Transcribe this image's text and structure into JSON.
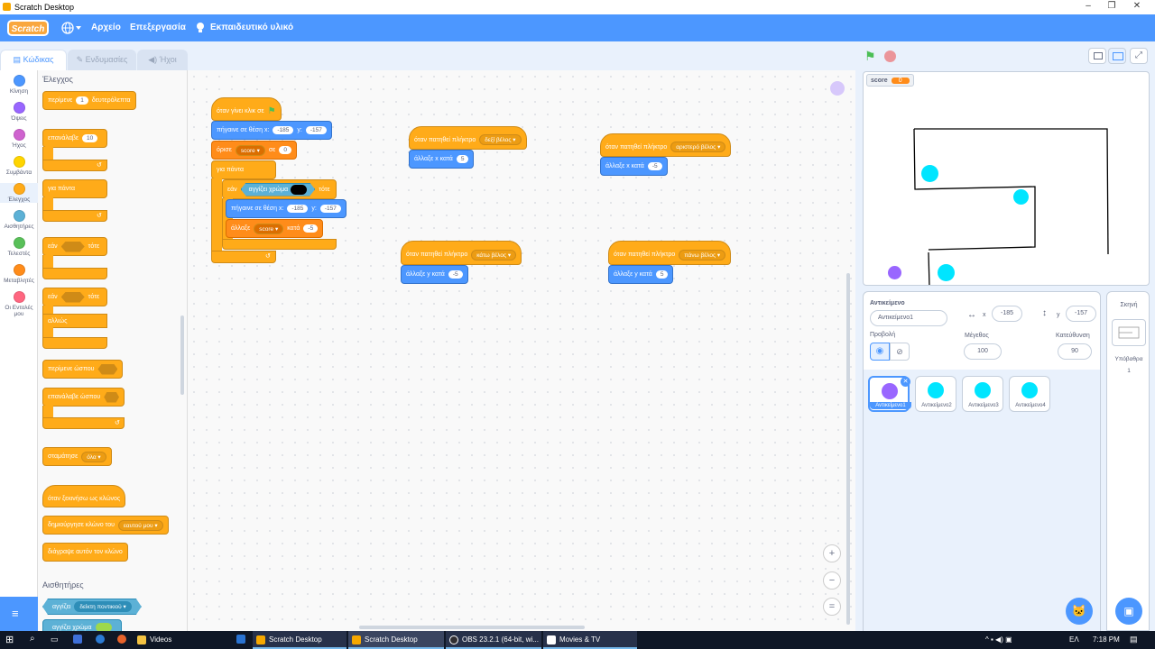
{
  "window": {
    "title": "Scratch Desktop",
    "minimize": "–",
    "restore": "❐",
    "close": "✕"
  },
  "menubar": {
    "logo": "Scratch",
    "file": "Αρχείο",
    "edit": "Επεξεργασία",
    "tutorials": "Εκπαιδευτικό υλικό"
  },
  "tabs": {
    "code": "Κώδικας",
    "costumes": "Ενδυμασίες",
    "sounds": "Ήχοι"
  },
  "categories": [
    {
      "label": "Κίνηση",
      "color": "#4c97ff"
    },
    {
      "label": "Όψεις",
      "color": "#9966ff"
    },
    {
      "label": "Ήχος",
      "color": "#cf63cf"
    },
    {
      "label": "Συμβάντα",
      "color": "#ffd500"
    },
    {
      "label": "Έλεγχος",
      "color": "#ffab19"
    },
    {
      "label": "Αισθητήρες",
      "color": "#5cb1d6"
    },
    {
      "label": "Τελεστές",
      "color": "#59c059"
    },
    {
      "label": "Μεταβλητές",
      "color": "#ff8c1a"
    },
    {
      "label": "Οι Εντολές μου",
      "color": "#ff6680"
    }
  ],
  "palette": {
    "heading": "Έλεγχος",
    "wait": "περίμενε",
    "wait_num": "1",
    "wait_unit": "δευτερόλεπτα",
    "repeat": "επανάλαβε",
    "repeat_num": "10",
    "forever": "για πάντα",
    "if": "εάν",
    "then": "τότε",
    "if2": "εάν",
    "then2": "τότε",
    "else": "αλλιώς",
    "wait_until": "περίμενε ώσπου",
    "repeat_until": "επανάλαβε ώσπου",
    "stop": "σταμάτησε",
    "stop_opt": "όλα",
    "clone_start": "όταν ξεκινήσω ως κλώνος",
    "create_clone": "δημιούργησε κλώνο του",
    "create_clone_opt": "εαυτού μου",
    "delete_clone": "διάγραψε αυτόν τον κλώνο",
    "sensing_heading": "Αισθητήρες",
    "touching": "αγγίζει",
    "touching_opt": "δείκτη ποντικιού",
    "touching_color": "αγγίζει χρώμα"
  },
  "scripts": {
    "flag_hat": "όταν γίνει κλικ σε",
    "goto": "πήγαινε σε θέση x:",
    "goto_x": "-185",
    "goto_y_label": "y:",
    "goto_y": "-157",
    "set": "όρισε",
    "set_var": "score",
    "set_to": "σε",
    "set_val": "0",
    "forever": "για πάντα",
    "if": "εάν",
    "touch_color": "αγγίζει χρώμα",
    "then": "τότε",
    "goto2": "πήγαινε σε θέση x:",
    "goto2_x": "-185",
    "goto2_y_label": "y:",
    "goto2_y": "-157",
    "change": "άλλαξε",
    "change_var": "score",
    "change_by": "κατά",
    "change_val": "-5",
    "right_hat": "όταν πατηθεί πλήκτρο",
    "right_key": "δεξί βέλος",
    "right_change": "άλλαξε x κατά",
    "right_val": "5",
    "left_hat": "όταν πατηθεί πλήκτρο",
    "left_key": "αριστερό βέλος",
    "left_change": "άλλαξε x κατά",
    "left_val": "-5",
    "down_hat": "όταν πατηθεί πλήκτρο",
    "down_key": "κάτω βέλος",
    "down_change": "άλλαξε y κατά",
    "down_val": "-5",
    "up_hat": "όταν πατηθεί πλήκτρο",
    "up_key": "πάνω βέλος",
    "up_change": "άλλαξε y κατά",
    "up_val": "5"
  },
  "zoom": {
    "in": "+",
    "out": "−",
    "reset": "="
  },
  "stage": {
    "var_name": "score",
    "var_value": "0"
  },
  "sprite_info": {
    "label": "Αντικείμενο",
    "name": "Αντικείμενο1",
    "x_label": "x",
    "x": "-185",
    "y_label": "y",
    "y": "-157",
    "show_label": "Προβολή",
    "size_label": "Μέγεθος",
    "size": "100",
    "dir_label": "Κατεύθυνση",
    "dir": "90"
  },
  "sprites": [
    {
      "name": "Αντικείμενο1",
      "color": "#9966ff"
    },
    {
      "name": "Αντικείμενο2",
      "color": "#00e5ff"
    },
    {
      "name": "Αντικείμενο3",
      "color": "#00e5ff"
    },
    {
      "name": "Αντικείμενο4",
      "color": "#00e5ff"
    }
  ],
  "stage_pane": {
    "title": "Σκηνή",
    "backdrops": "Υπόβαθρα",
    "backdrop_count": "1"
  },
  "taskbar": {
    "items": [
      "Videos",
      "Scratch Desktop",
      "Scratch Desktop",
      "OBS 23.2.1 (64-bit, wi...",
      "Movies & TV"
    ],
    "lang": "ΕΛ",
    "time": "7:18 PM"
  }
}
